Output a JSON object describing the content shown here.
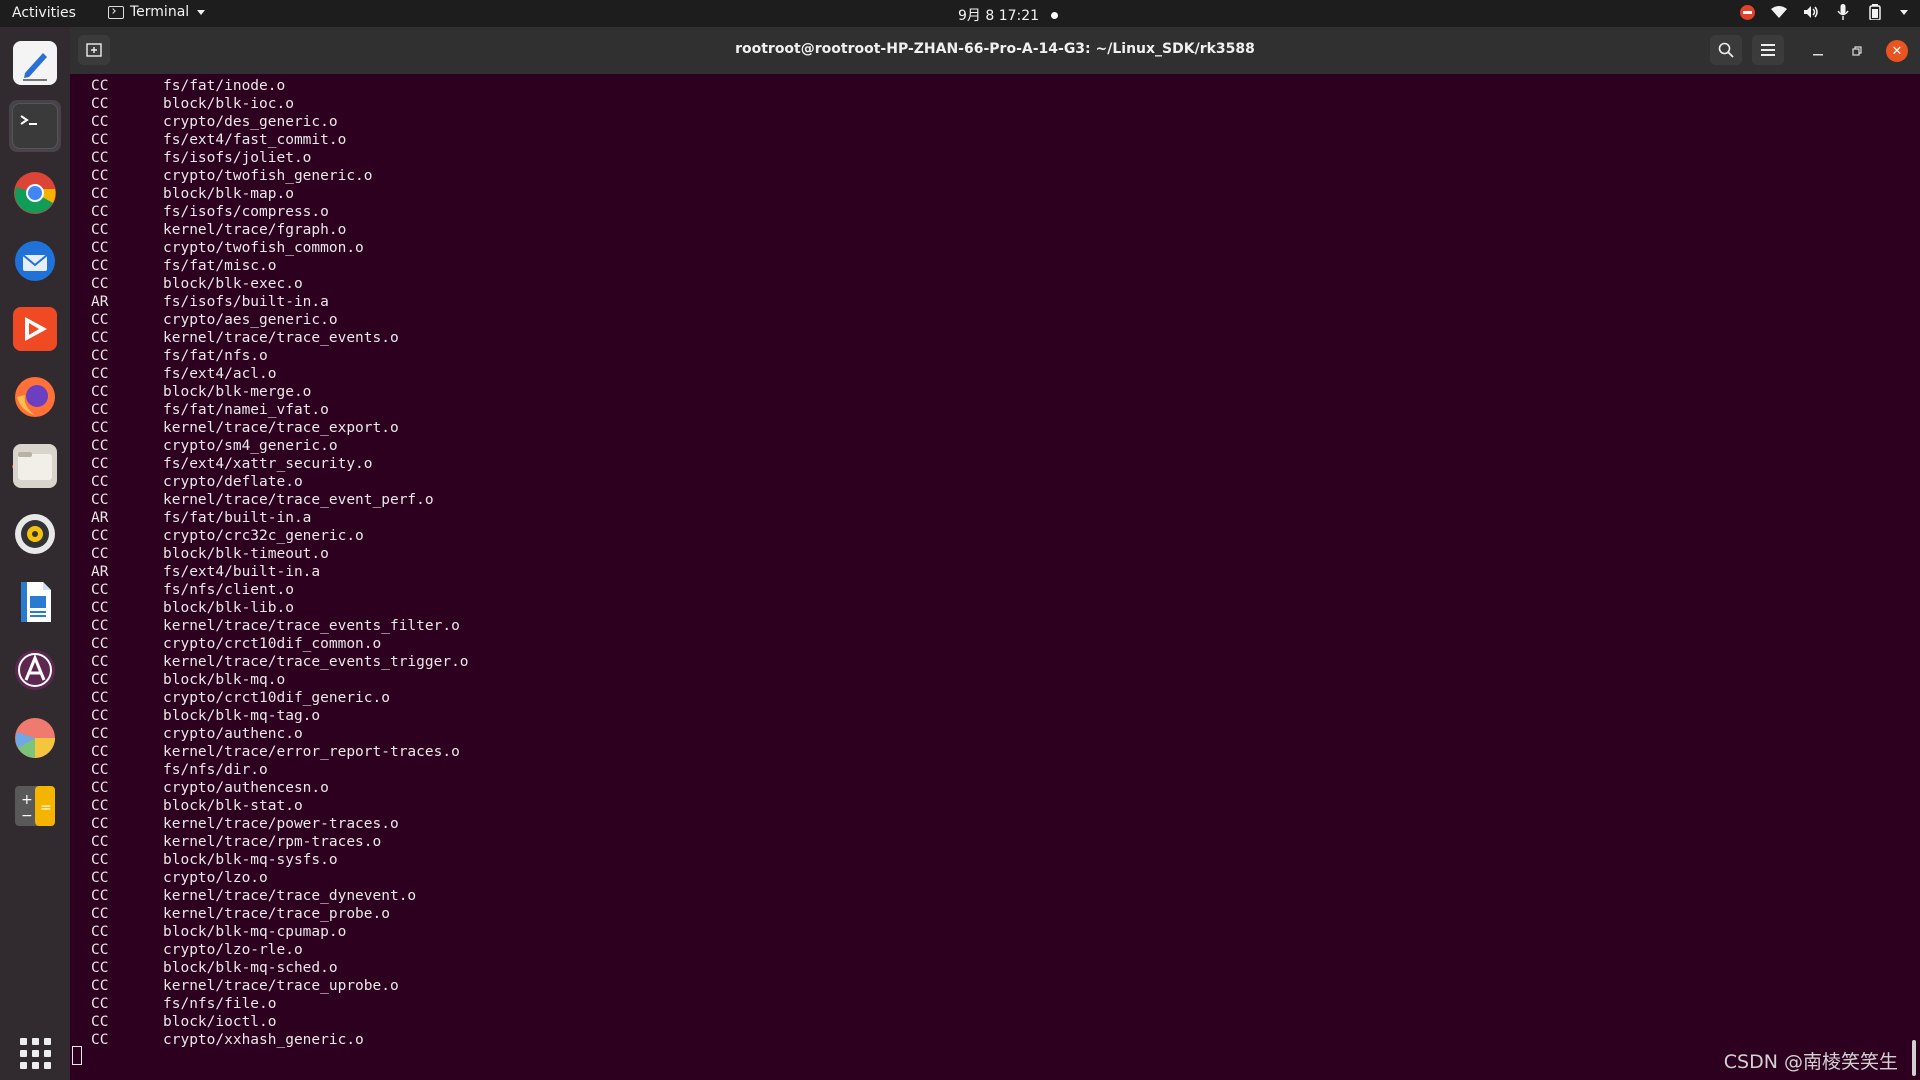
{
  "topbar": {
    "activities": "Activities",
    "app_name": "Terminal",
    "clock": "9月 8  17:21"
  },
  "window": {
    "title": "rootroot@rootroot-HP-ZHAN-66-Pro-A-14-G3: ~/Linux_SDK/rk3588"
  },
  "dock": {
    "items": [
      "text-editor",
      "terminal",
      "chrome",
      "thunderbird",
      "video-app",
      "firefox",
      "files",
      "rhythmbox",
      "libreoffice-writer",
      "software-center",
      "color-app",
      "calculator"
    ],
    "show_apps": "show-applications"
  },
  "terminal": {
    "lines": [
      {
        "tag": "CC",
        "path": "fs/fat/inode.o"
      },
      {
        "tag": "CC",
        "path": "block/blk-ioc.o"
      },
      {
        "tag": "CC",
        "path": "crypto/des_generic.o"
      },
      {
        "tag": "CC",
        "path": "fs/ext4/fast_commit.o"
      },
      {
        "tag": "CC",
        "path": "fs/isofs/joliet.o"
      },
      {
        "tag": "CC",
        "path": "crypto/twofish_generic.o"
      },
      {
        "tag": "CC",
        "path": "block/blk-map.o"
      },
      {
        "tag": "CC",
        "path": "fs/isofs/compress.o"
      },
      {
        "tag": "CC",
        "path": "kernel/trace/fgraph.o"
      },
      {
        "tag": "CC",
        "path": "crypto/twofish_common.o"
      },
      {
        "tag": "CC",
        "path": "fs/fat/misc.o"
      },
      {
        "tag": "CC",
        "path": "block/blk-exec.o"
      },
      {
        "tag": "AR",
        "path": "fs/isofs/built-in.a"
      },
      {
        "tag": "CC",
        "path": "crypto/aes_generic.o"
      },
      {
        "tag": "CC",
        "path": "kernel/trace/trace_events.o"
      },
      {
        "tag": "CC",
        "path": "fs/fat/nfs.o"
      },
      {
        "tag": "CC",
        "path": "fs/ext4/acl.o"
      },
      {
        "tag": "CC",
        "path": "block/blk-merge.o"
      },
      {
        "tag": "CC",
        "path": "fs/fat/namei_vfat.o"
      },
      {
        "tag": "CC",
        "path": "kernel/trace/trace_export.o"
      },
      {
        "tag": "CC",
        "path": "crypto/sm4_generic.o"
      },
      {
        "tag": "CC",
        "path": "fs/ext4/xattr_security.o"
      },
      {
        "tag": "CC",
        "path": "crypto/deflate.o"
      },
      {
        "tag": "CC",
        "path": "kernel/trace/trace_event_perf.o"
      },
      {
        "tag": "AR",
        "path": "fs/fat/built-in.a"
      },
      {
        "tag": "CC",
        "path": "crypto/crc32c_generic.o"
      },
      {
        "tag": "CC",
        "path": "block/blk-timeout.o"
      },
      {
        "tag": "AR",
        "path": "fs/ext4/built-in.a"
      },
      {
        "tag": "CC",
        "path": "fs/nfs/client.o"
      },
      {
        "tag": "CC",
        "path": "block/blk-lib.o"
      },
      {
        "tag": "CC",
        "path": "kernel/trace/trace_events_filter.o"
      },
      {
        "tag": "CC",
        "path": "crypto/crct10dif_common.o"
      },
      {
        "tag": "CC",
        "path": "kernel/trace/trace_events_trigger.o"
      },
      {
        "tag": "CC",
        "path": "block/blk-mq.o"
      },
      {
        "tag": "CC",
        "path": "crypto/crct10dif_generic.o"
      },
      {
        "tag": "CC",
        "path": "block/blk-mq-tag.o"
      },
      {
        "tag": "CC",
        "path": "crypto/authenc.o"
      },
      {
        "tag": "CC",
        "path": "kernel/trace/error_report-traces.o"
      },
      {
        "tag": "CC",
        "path": "fs/nfs/dir.o"
      },
      {
        "tag": "CC",
        "path": "crypto/authencesn.o"
      },
      {
        "tag": "CC",
        "path": "block/blk-stat.o"
      },
      {
        "tag": "CC",
        "path": "kernel/trace/power-traces.o"
      },
      {
        "tag": "CC",
        "path": "kernel/trace/rpm-traces.o"
      },
      {
        "tag": "CC",
        "path": "block/blk-mq-sysfs.o"
      },
      {
        "tag": "CC",
        "path": "crypto/lzo.o"
      },
      {
        "tag": "CC",
        "path": "kernel/trace/trace_dynevent.o"
      },
      {
        "tag": "CC",
        "path": "kernel/trace/trace_probe.o"
      },
      {
        "tag": "CC",
        "path": "block/blk-mq-cpumap.o"
      },
      {
        "tag": "CC",
        "path": "crypto/lzo-rle.o"
      },
      {
        "tag": "CC",
        "path": "block/blk-mq-sched.o"
      },
      {
        "tag": "CC",
        "path": "kernel/trace/trace_uprobe.o"
      },
      {
        "tag": "CC",
        "path": "fs/nfs/file.o"
      },
      {
        "tag": "CC",
        "path": "block/ioctl.o"
      },
      {
        "tag": "CC",
        "path": "crypto/xxhash_generic.o"
      }
    ]
  },
  "watermark": "CSDN @南棱笑笑生",
  "colors": {
    "terminal_bg": "#2c001e",
    "terminal_fg": "#e8e8e8",
    "accent": "#e95420"
  }
}
